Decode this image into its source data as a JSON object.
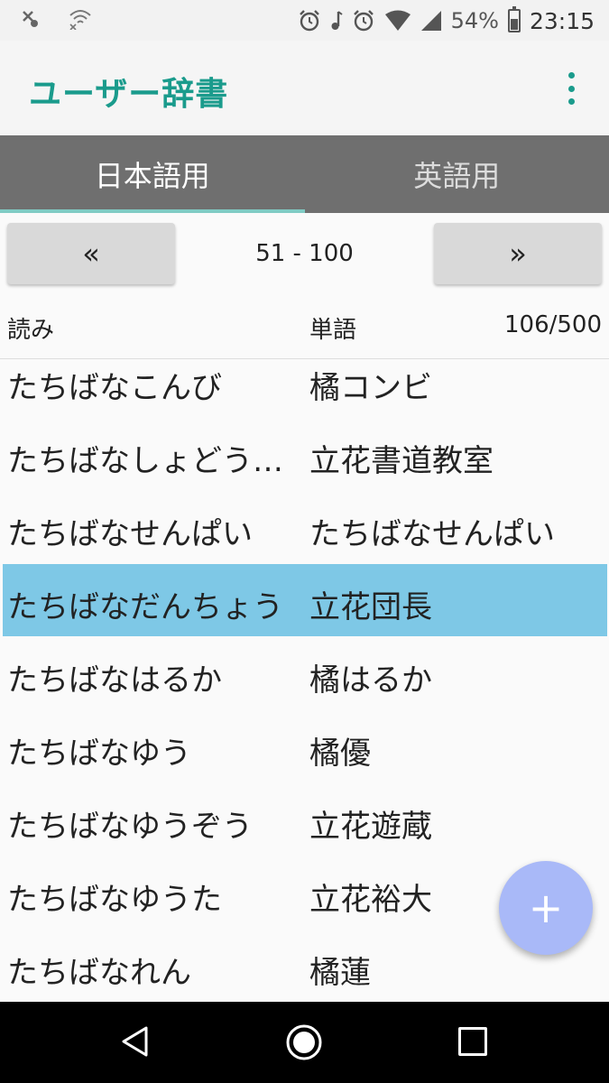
{
  "status_bar": {
    "battery": "54%",
    "time": "23:15"
  },
  "app_bar": {
    "title": "ユーザー辞書"
  },
  "tabs": [
    {
      "label": "日本語用",
      "active": true
    },
    {
      "label": "英語用",
      "active": false
    }
  ],
  "pager": {
    "prev_label": "«",
    "next_label": "»",
    "range": "51 - 100"
  },
  "header": {
    "reading": "読み",
    "word": "単語",
    "count": "106/500"
  },
  "entries": [
    {
      "reading": "たちばなこんび",
      "word": "橘コンビ"
    },
    {
      "reading": "たちばなしょどうきょうしつ",
      "word": "立花書道教室"
    },
    {
      "reading": "たちばなせんぱい",
      "word": "たちばなせんぱい"
    },
    {
      "reading": "たちばなだんちょう",
      "word": "立花団長",
      "selected": true
    },
    {
      "reading": "たちばなはるか",
      "word": "橘はるか"
    },
    {
      "reading": "たちばなゆう",
      "word": "橘優"
    },
    {
      "reading": "たちばなゆうぞう",
      "word": "立花遊蔵"
    },
    {
      "reading": "たちばなゆうた",
      "word": "立花裕大"
    },
    {
      "reading": "たちばなれん",
      "word": "橘蓮"
    }
  ],
  "fab": {
    "label": "+"
  },
  "colors": {
    "accent": "#1a9b8c",
    "tab_bar": "#6f6f6f",
    "selected_row": "#7ec8e6",
    "fab": "#a9b9f8"
  }
}
